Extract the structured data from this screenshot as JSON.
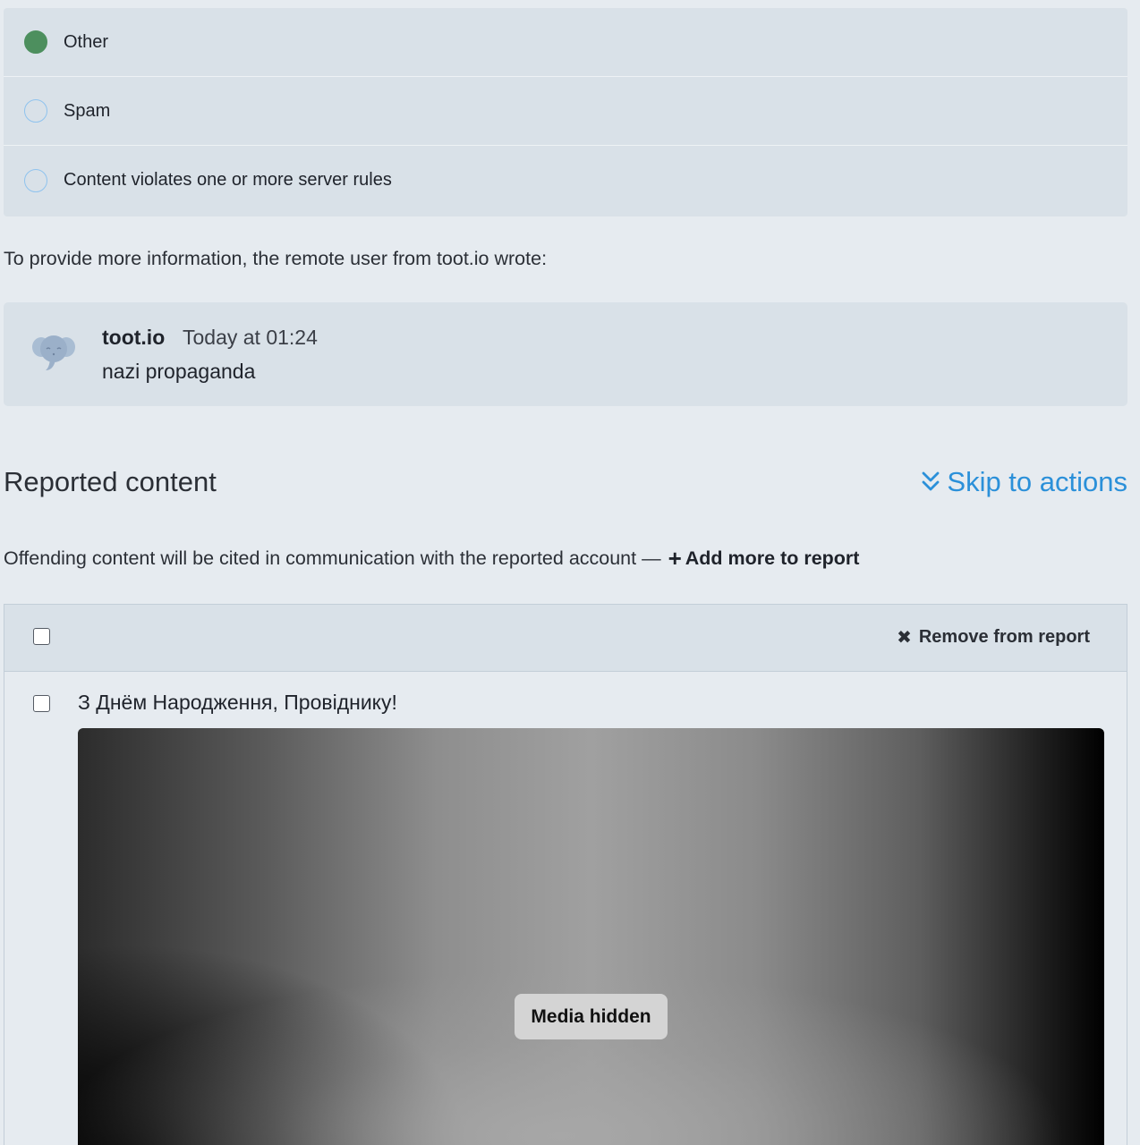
{
  "categories": [
    {
      "label": "Other",
      "checked": true
    },
    {
      "label": "Spam",
      "checked": false
    },
    {
      "label": "Content violates one or more server rules",
      "checked": false
    }
  ],
  "intro_text": "To provide more information, the remote user from toot.io wrote:",
  "comment": {
    "author": "toot.io",
    "time": "Today at 01:24",
    "body": "nazi propaganda",
    "avatar_icon": "mastodon-elephant-icon"
  },
  "section": {
    "title": "Reported content",
    "skip_link": "Skip to actions",
    "offend_text": "Offending content will be cited in communication with the reported account —",
    "add_more": "Add more to report"
  },
  "table": {
    "remove_label": "Remove from report",
    "status_text": "З Днём Народження, Провіднику!",
    "media_label": "Media hidden"
  },
  "colors": {
    "accent": "#2b90d9",
    "radio_checked": "#4d8f5e",
    "background": "#e6ebf0",
    "panel": "#d9e1e8"
  }
}
